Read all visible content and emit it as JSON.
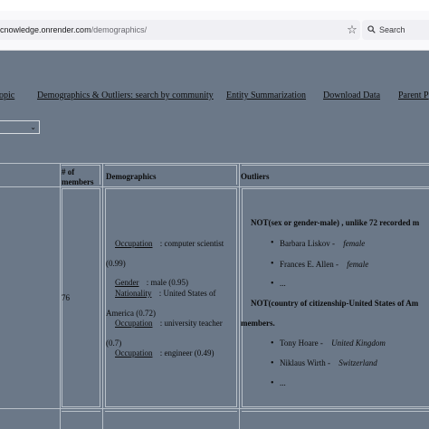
{
  "browser": {
    "url_host": "cnowledge.onrender.com",
    "url_path": "/demographics/",
    "search_placeholder": "Search"
  },
  "nav": {
    "items": [
      "opic",
      "Demographics & Outliers: search by community",
      "Entity Summarization",
      "Download Data",
      "Parent P"
    ]
  },
  "table": {
    "headers": {
      "members_line1": "# of",
      "members_line2": "members",
      "demographics": "Demographics",
      "outliers": "Outliers"
    },
    "row": {
      "members": "76",
      "demographics": [
        {
          "key": "Occupation",
          "value": ": computer scientist",
          "score": "(0.99)"
        },
        {
          "key": "Gender",
          "value": ": male (0.95)"
        },
        {
          "key": "Nationality",
          "value": ": United States of",
          "cont": "America (0.72)"
        },
        {
          "key": "Occupation",
          "value": ": university teacher",
          "score": "(0.7)"
        },
        {
          "key": "Occupation",
          "value": ": engineer (0.49)"
        }
      ],
      "outliers": {
        "heading1": "NOT(sex or gender-male) , unlike 72 recorded m",
        "group1": [
          {
            "name": "Barbara Liskov -",
            "value": "female"
          },
          {
            "name": "Frances E. Allen -",
            "value": "female"
          }
        ],
        "more1": "...",
        "heading2a": "NOT(country of citizenship-United States of Am",
        "heading2b": "members.",
        "group2": [
          {
            "name": "Tony Hoare -",
            "value": "United Kingdom"
          },
          {
            "name": "Niklaus Wirth -",
            "value": "Switzerland"
          }
        ],
        "more2": "..."
      }
    }
  },
  "colors": {
    "page_background": "#6b7888",
    "table_border": "#b8c0c8",
    "toolbar": "#f9f9fb"
  }
}
